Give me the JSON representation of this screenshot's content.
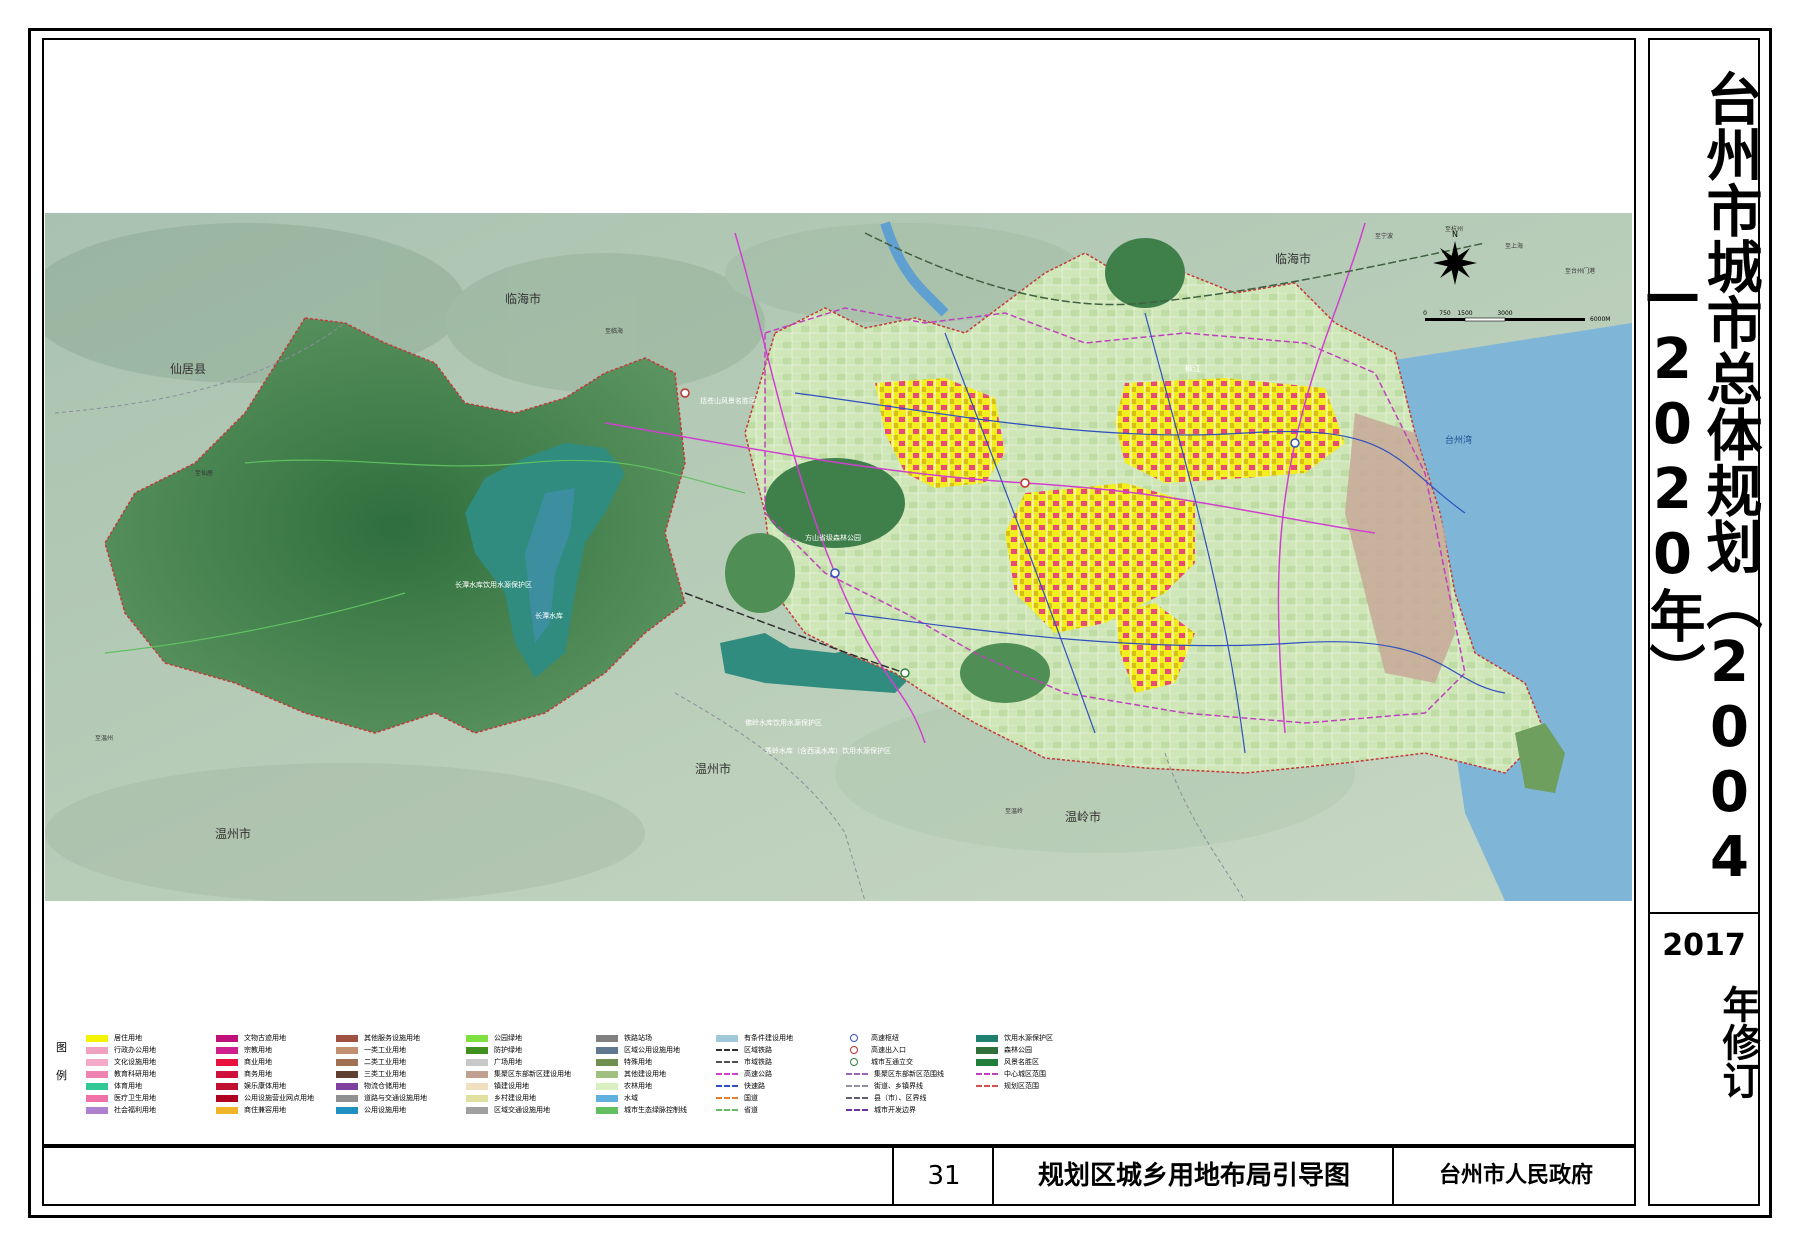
{
  "plan": {
    "title": "台州市城市总体规划（2004—2020年）",
    "revision_year": "2017",
    "revision_label": "年修订"
  },
  "footer": {
    "sheet_number": "31",
    "sheet_title": "规划区城乡用地布局引导图",
    "authority": "台州市人民政府"
  },
  "map": {
    "place_labels": [
      "临海市",
      "临海市",
      "仙居县",
      "温州市",
      "温州市",
      "温岭市",
      "台州湾",
      "椒江",
      "长潭水库饮用水源保护区",
      "长潭水库",
      "佛岭水库饮用水源保护区",
      "秀岭水库（含西溪水库）饮用水源保护区",
      "方山省级森林公园",
      "括苍山风景名胜区",
      "至仙居",
      "至温州",
      "至温岭",
      "至临海",
      "至杭州",
      "至宁波",
      "至上海",
      "至台州门港"
    ],
    "scale_ticks": [
      "0",
      "750",
      "1500",
      "3000",
      "6000M"
    ],
    "north_label": "N"
  },
  "legend": {
    "heading": "图例",
    "columns": [
      [
        {
          "label": "居住用地",
          "color": "#f4f400",
          "kind": "fill"
        },
        {
          "label": "行政办公用地",
          "color": "#f0a0c0",
          "kind": "fill"
        },
        {
          "label": "文化设施用地",
          "color": "#f4a9c8",
          "kind": "fill"
        },
        {
          "label": "教育科研用地",
          "color": "#ee82b0",
          "kind": "fill"
        },
        {
          "label": "体育用地",
          "color": "#32c896",
          "kind": "fill"
        },
        {
          "label": "医疗卫生用地",
          "color": "#f070a8",
          "kind": "fill"
        },
        {
          "label": "社会福利用地",
          "color": "#b080d0",
          "kind": "fill"
        }
      ],
      [
        {
          "label": "文物古迹用地",
          "color": "#c0107a",
          "kind": "fill"
        },
        {
          "label": "宗教用地",
          "color": "#d02090",
          "kind": "fill"
        },
        {
          "label": "商业用地",
          "color": "#e8103c",
          "kind": "fill"
        },
        {
          "label": "商务用地",
          "color": "#d0103c",
          "kind": "fill"
        },
        {
          "label": "娱乐康体用地",
          "color": "#c01030",
          "kind": "fill"
        },
        {
          "label": "公用设施营业网点用地",
          "color": "#b00020",
          "kind": "fill"
        },
        {
          "label": "商住兼容用地",
          "color": "#f0b428",
          "kind": "fill"
        }
      ],
      [
        {
          "label": "其他服务设施用地",
          "color": "#a05040",
          "kind": "fill"
        },
        {
          "label": "一类工业用地",
          "color": "#c09070",
          "kind": "fill"
        },
        {
          "label": "二类工业用地",
          "color": "#a07050",
          "kind": "fill"
        },
        {
          "label": "三类工业用地",
          "color": "#604030",
          "kind": "fill"
        },
        {
          "label": "物流仓储用地",
          "color": "#8040a0",
          "kind": "fill"
        },
        {
          "label": "道路与交通设施用地",
          "color": "#909090",
          "kind": "fill"
        },
        {
          "label": "公用设施用地",
          "color": "#2090c0",
          "kind": "fill"
        }
      ],
      [
        {
          "label": "公园绿地",
          "color": "#80e040",
          "kind": "fill"
        },
        {
          "label": "防护绿地",
          "color": "#409020",
          "kind": "fill"
        },
        {
          "label": "广场用地",
          "color": "#c8c8c8",
          "kind": "fill"
        },
        {
          "label": "集聚区东部新区建设用地",
          "color": "#c0a090",
          "kind": "fill"
        },
        {
          "label": "镇建设用地",
          "color": "#f0e0c0",
          "kind": "fill"
        },
        {
          "label": "乡村建设用地",
          "color": "#e0e0a0",
          "kind": "fill"
        },
        {
          "label": "区域交通设施用地",
          "color": "#a0a0a0",
          "kind": "fill"
        }
      ],
      [
        {
          "label": "铁路站场",
          "color": "#808080",
          "kind": "fill"
        },
        {
          "label": "区域公用设施用地",
          "color": "#607890",
          "kind": "fill"
        },
        {
          "label": "特殊用地",
          "color": "#709050",
          "kind": "fill"
        },
        {
          "label": "其他建设用地",
          "color": "#a0c080",
          "kind": "fill"
        },
        {
          "label": "农林用地",
          "color": "#d8f0c0",
          "kind": "fill"
        },
        {
          "label": "水域",
          "color": "#60b0e0",
          "kind": "fill"
        },
        {
          "label": "城市生态绿脉控制线",
          "color": "#60c060",
          "kind": "fill"
        }
      ],
      [
        {
          "label": "有条件建设用地",
          "color": "#a0c8d8",
          "kind": "fill"
        },
        {
          "label": "区域铁路",
          "color": "#303030",
          "kind": "line"
        },
        {
          "label": "市域铁路",
          "color": "#505050",
          "kind": "line"
        },
        {
          "label": "高速公路",
          "color": "#d040d0",
          "kind": "line"
        },
        {
          "label": "快速路",
          "color": "#3050c0",
          "kind": "line"
        },
        {
          "label": "国道",
          "color": "#e08030",
          "kind": "line"
        },
        {
          "label": "省道",
          "color": "#60c060",
          "kind": "line"
        }
      ],
      [
        {
          "label": "高速枢纽",
          "color": "#3050c0",
          "kind": "dot"
        },
        {
          "label": "高速出入口",
          "color": "#c03030",
          "kind": "dot"
        },
        {
          "label": "城市互通立交",
          "color": "#308040",
          "kind": "dot"
        },
        {
          "label": "集聚区东部新区范围线",
          "color": "#a060c0",
          "kind": "line"
        },
        {
          "label": "街道、乡镇界线",
          "color": "#9090a0",
          "kind": "line"
        },
        {
          "label": "县（市）、区界线",
          "color": "#606070",
          "kind": "line"
        },
        {
          "label": "城市开发边界",
          "color": "#7030a0",
          "kind": "line"
        }
      ],
      [
        {
          "label": "饮用水源保护区",
          "color": "#208070",
          "kind": "fill"
        },
        {
          "label": "森林公园",
          "color": "#2f6f3a",
          "kind": "fill"
        },
        {
          "label": "风景名胜区",
          "color": "#1f7f3a",
          "kind": "fill"
        },
        {
          "label": "中心城区范围",
          "color": "#c040c0",
          "kind": "line"
        },
        {
          "label": "规划区范围",
          "color": "#d05050",
          "kind": "line"
        }
      ]
    ]
  }
}
